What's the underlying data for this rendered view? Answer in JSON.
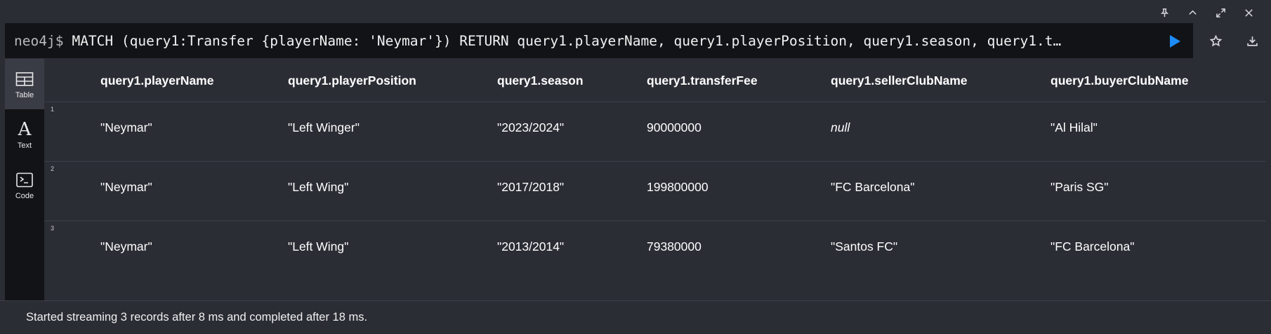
{
  "window_controls": [
    "pin-icon",
    "collapse-icon",
    "expand-icon",
    "close-icon"
  ],
  "editor": {
    "prompt": "neo4j$",
    "query": "MATCH (query1:Transfer {playerName: 'Neymar'}) RETURN query1.playerName, query1.playerPosition, query1.season, query1.t…",
    "run_icon": "play-icon",
    "accent_color": "#1d8cf8"
  },
  "side_actions": [
    "star-icon",
    "download-icon"
  ],
  "views": [
    {
      "label": "Table",
      "icon": "table-icon",
      "active": true
    },
    {
      "label": "Text",
      "icon": "text-icon",
      "active": false
    },
    {
      "label": "Code",
      "icon": "code-icon",
      "active": false
    }
  ],
  "table": {
    "columns": [
      "query1.playerName",
      "query1.playerPosition",
      "query1.season",
      "query1.transferFee",
      "query1.sellerClubName",
      "query1.buyerClubName"
    ],
    "rows": [
      {
        "num": "1",
        "cells": [
          "\"Neymar\"",
          "\"Left Winger\"",
          "\"2023/2024\"",
          "90000000",
          "null",
          "\"Al Hilal\""
        ]
      },
      {
        "num": "2",
        "cells": [
          "\"Neymar\"",
          "\"Left Wing\"",
          "\"2017/2018\"",
          "199800000",
          "\"FC Barcelona\"",
          "\"Paris SG\""
        ]
      },
      {
        "num": "3",
        "cells": [
          "\"Neymar\"",
          "\"Left Wing\"",
          "\"2013/2014\"",
          "79380000",
          "\"Santos FC\"",
          "\"FC Barcelona\""
        ]
      }
    ]
  },
  "status": "Started streaming 3 records after 8 ms and completed after 18 ms."
}
